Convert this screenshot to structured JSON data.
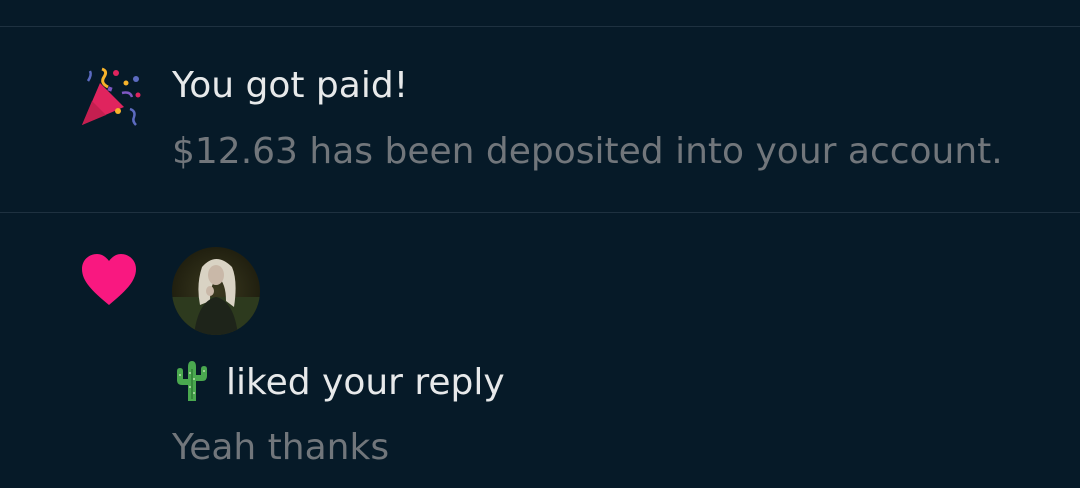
{
  "notifications": [
    {
      "icon": "party-popper-icon",
      "title": "You got paid!",
      "body": "$12.63 has been deposited into your account."
    },
    {
      "icon": "heart-icon",
      "icon_color": "#f91880",
      "actor_avatar": "user-avatar",
      "actor_emoji": "cactus-icon",
      "action_text": "liked your reply",
      "reply_text": "Yeah thanks"
    }
  ],
  "theme": {
    "background": "#061a28",
    "primary_text": "#e7e9ea",
    "secondary_text": "#71767b",
    "divider": "#1e3140",
    "like_color": "#f91880"
  }
}
